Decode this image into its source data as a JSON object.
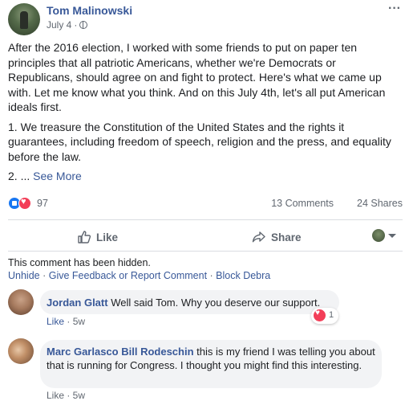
{
  "post": {
    "author": "Tom Malinowski",
    "date": "July 4",
    "separator": "·",
    "menu_icon": "more-icon",
    "paragraph1": "After the 2016 election, I worked with some friends to put on paper ten principles that all patriotic Americans, whether we're Democrats or Republicans, should agree on and fight to protect. Here's what we came up with. Let me know what you think. And on this July 4th, let's all put American ideals first.",
    "paragraph2": "1. We treasure the Constitution of the United States and the rights it guarantees, including freedom of speech, religion and the press, and equality before the law.",
    "paragraph3_prefix": "2. ... ",
    "see_more": "See More"
  },
  "stats": {
    "reactions_count": "97",
    "comments": "13 Comments",
    "shares": "24 Shares"
  },
  "actions": {
    "like_label": "Like",
    "share_label": "Share"
  },
  "hidden_comment": {
    "note": "This comment has been hidden.",
    "unhide": "Unhide",
    "feedback": "Give Feedback or Report Comment",
    "block": "Block Debra",
    "sep": " · "
  },
  "comments": [
    {
      "name": "Jordan Glatt",
      "text": "Well said Tom. Why you deserve our support.",
      "reaction_count": "1",
      "like_label": "Like",
      "time": "5w",
      "sep": " · "
    },
    {
      "name": "Marc Garlasco",
      "tagged": "Bill Rodeschin",
      "text": "this is my friend I was telling you about that is running for Congress. I thought you might find this interesting.",
      "meta": "Like · 5w"
    }
  ],
  "colors": {
    "link": "#385898",
    "secondary": "#606770",
    "like_blue": "#1877f2",
    "love_red": "#f33e58"
  }
}
